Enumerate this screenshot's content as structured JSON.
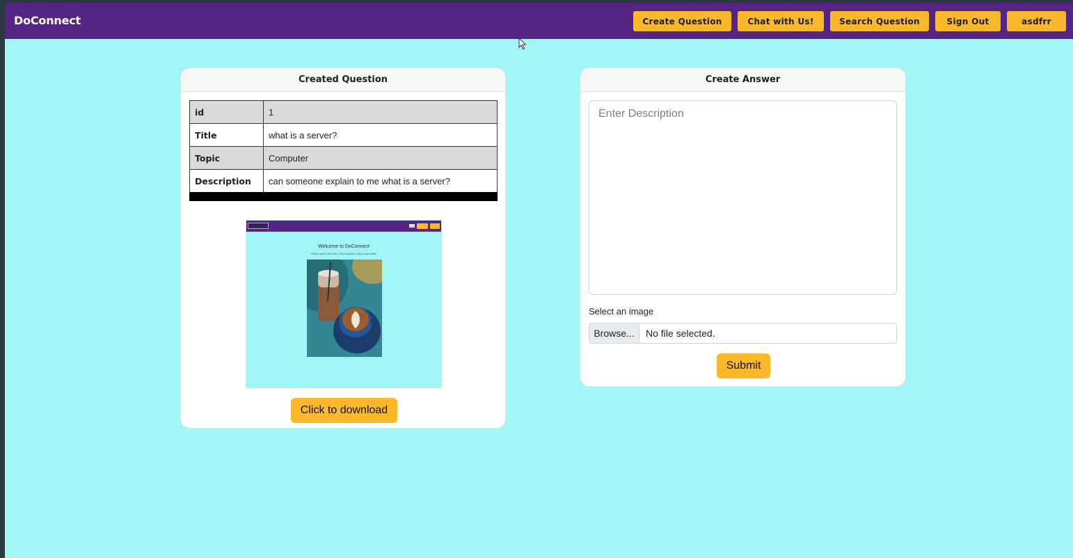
{
  "navbar": {
    "brand": "DoConnect",
    "buttons": [
      "Create Question",
      "Chat with Us!",
      "Search Question",
      "Sign Out",
      "asdfrr"
    ]
  },
  "question_card": {
    "header": "Created Question",
    "rows": [
      {
        "key": "id",
        "value": "1"
      },
      {
        "key": "Title",
        "value": "what is a server?"
      },
      {
        "key": "Topic",
        "value": "Computer"
      },
      {
        "key": "Description",
        "value": "can someone explain to me what is a server?"
      }
    ],
    "preview": {
      "title": "Welcome to DoConnect",
      "subtitle": "Please wait for the form, in the meantime, enjoy some coffee"
    },
    "download_label": "Click to download"
  },
  "answer_card": {
    "header": "Create Answer",
    "description_placeholder": "Enter Description",
    "image_label": "Select an image",
    "browse_label": "Browse...",
    "file_status": "No file selected.",
    "submit_label": "Submit"
  },
  "colors": {
    "navbar": "#542583",
    "accent": "#fbb82b",
    "background": "#a0f5f5"
  }
}
